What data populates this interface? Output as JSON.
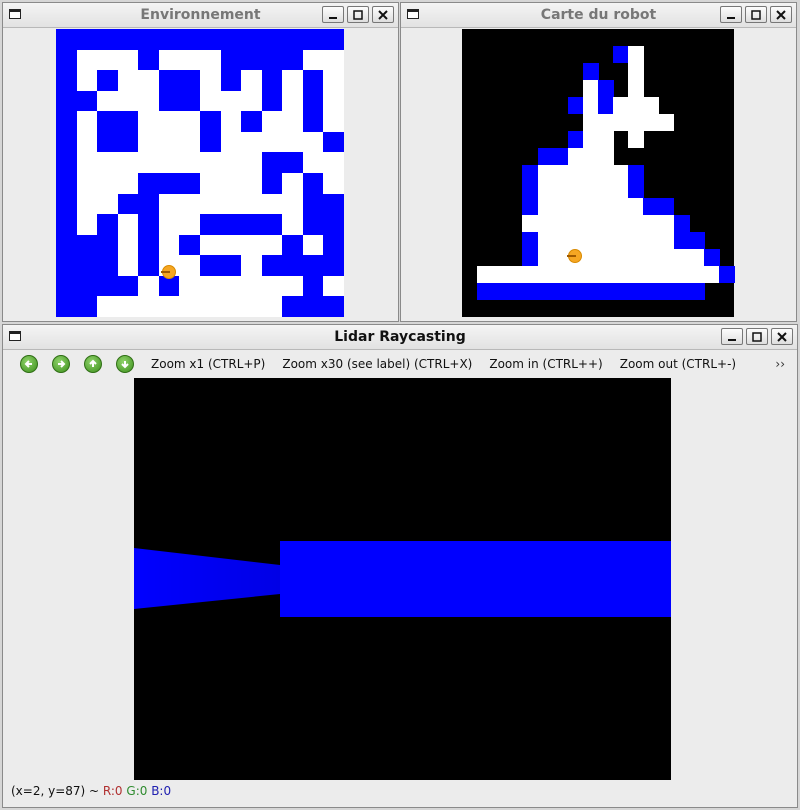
{
  "windows": {
    "environment": {
      "title": "Environnement",
      "grid": {
        "cols": 14,
        "rows": 14,
        "wall_color": "#0000ff",
        "free_color": "#ffffff",
        "cells": [
          "11111111111111",
          "10001000111100",
          "10100110101010",
          "11000110001010",
          "10110001010010",
          "10110001000001",
          "10000000001100",
          "10001110001010",
          "10011000000011",
          "10101001111011",
          "11101010000101",
          "11101001101111",
          "11110100000010",
          "11000000000111"
        ]
      },
      "robot": {
        "col": 5.5,
        "row": 11.8
      }
    },
    "robot_map": {
      "title": "Carte du robot",
      "grid": {
        "cols": 17,
        "rows": 17,
        "wall_color": "#0000ff",
        "free_color": "#ffffff",
        "unknown_color": "#000000",
        "cells": [
          "??????????????????",
          "??????????W1??????",
          "????????W??1??????",
          "????????1W?1??????",
          "???????W1W111?????",
          "????????111111????",
          "???????W11?1??????",
          "?????WW111??????? ",
          "????W111111W??????",
          "????W111111W??????",
          "????W1111111WW????",
          "????1111111111W???",
          "????W111111111WW??",
          "????W11111111111W?",
          "?1111111111111111W",
          "?WWWWWWWWWWWWWWW??",
          "??????????????????"
        ]
      },
      "robot": {
        "col": 7.5,
        "row": 13.4
      }
    },
    "lidar": {
      "title": "Lidar Raycasting",
      "toolbar": {
        "zoom1": "Zoom x1 (CTRL+P)",
        "zoom30": "Zoom x30 (see label) (CTRL+X)",
        "zoom_in": "Zoom in (CTRL++)",
        "zoom_out": "Zoom out (CTRL+-)",
        "more": "››"
      },
      "status": {
        "coords": "(x=2, y=87) ~",
        "r": "R:0",
        "g": "G:0",
        "b": "B:0"
      },
      "scene": {
        "background": "#000000",
        "wall_color": "#0000ff"
      }
    }
  }
}
